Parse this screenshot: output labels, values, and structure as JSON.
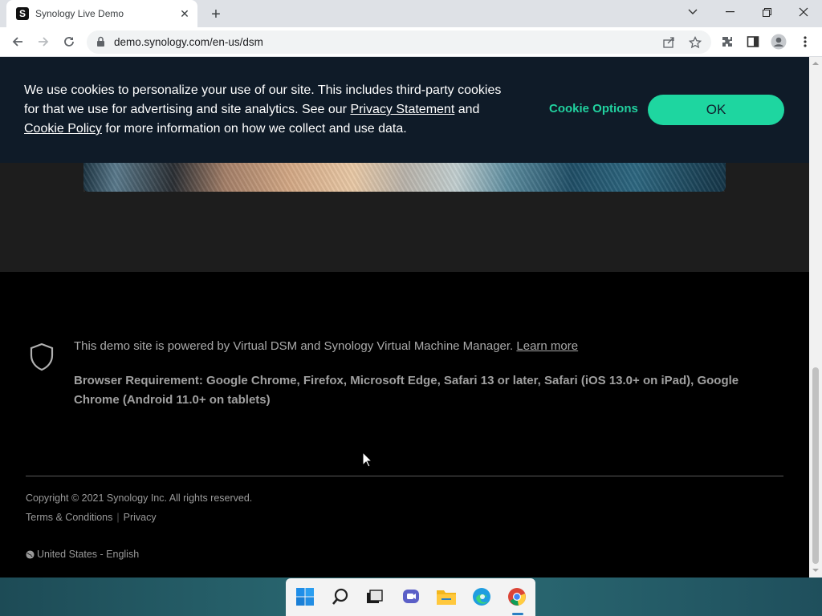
{
  "browser": {
    "tab_title": "Synology Live Demo",
    "favicon_letter": "S",
    "url": "demo.synology.com/en-us/dsm"
  },
  "cookie_banner": {
    "text_line1": "We use cookies to personalize your use of our site. This includes third-party cookies",
    "text_line2a": "for that we use for advertising and site analytics. See our ",
    "privacy_link": "Privacy Statement",
    "text_line2b": " and",
    "cookie_policy_link": "Cookie Policy",
    "text_line3": " for more information on how we collect and use data.",
    "cookie_options_label": "Cookie Options",
    "ok_label": "OK",
    "accent_color": "#1ed6a0"
  },
  "footer": {
    "powered_text": "This demo site is powered by Virtual DSM and Synology Virtual Machine Manager. ",
    "learn_more": "Learn more",
    "requirement": "Browser Requirement: Google Chrome, Firefox, Microsoft Edge, Safari 13 or later, Safari (iOS 13.0+ on iPad), Google Chrome (Android 11.0+ on tablets)",
    "copyright": "Copyright © 2021 Synology Inc. All rights reserved.",
    "terms": "Terms & Conditions",
    "separator": "|",
    "privacy": "Privacy",
    "locale": "United States - English"
  },
  "taskbar": {
    "apps": [
      "start-icon",
      "search-icon",
      "task-view-icon",
      "chat-icon",
      "file-explorer-icon",
      "edge-icon",
      "chrome-icon"
    ],
    "active_app": "chrome-icon"
  }
}
